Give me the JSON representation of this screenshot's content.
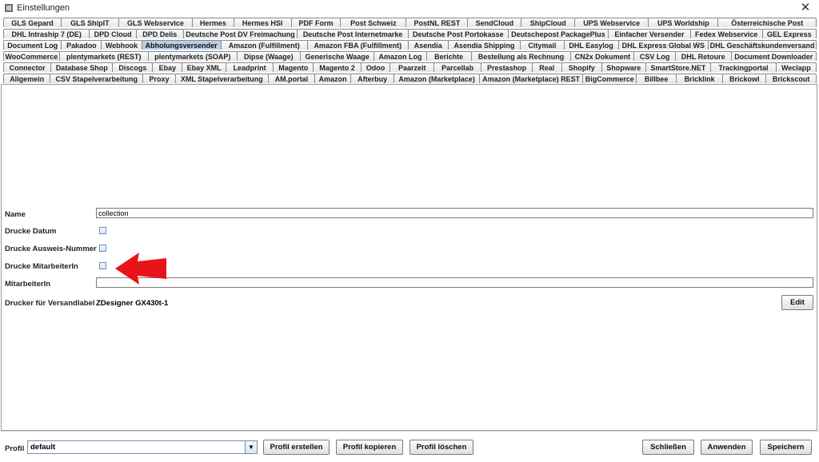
{
  "window": {
    "title": "Einstellungen",
    "close": "✕"
  },
  "tabs": {
    "rows": [
      [
        "GLS Gepard",
        "GLS ShipIT",
        "GLS Webservice",
        "Hermes",
        "Hermes HSI",
        "PDF Form",
        "Post Schweiz",
        "PostNL REST",
        "SendCloud",
        "ShipCloud",
        "UPS Webservice",
        "UPS Worldship",
        "Österreichische Post"
      ],
      [
        "DHL Intraship 7 (DE)",
        "DPD Cloud",
        "DPD Delis",
        "Deutsche Post DV Freimachung",
        "Deutsche Post Internetmarke",
        "Deutsche Post Portokasse",
        "Deutschepost PackagePlus",
        "Einfacher Versender",
        "Fedex Webservice",
        "GEL Express"
      ],
      [
        "Document Log",
        "Pakadoo",
        "Webhook",
        "Abholungsversender",
        "Amazon (Fulfillment)",
        "Amazon FBA (Fulfillment)",
        "Asendia",
        "Asendia Shipping",
        "Citymail",
        "DHL Easylog",
        "DHL Express Global WS",
        "DHL Geschäftskundenversand"
      ],
      [
        "WooCommerce",
        "plentymarkets (REST)",
        "plentymarkets (SOAP)",
        "Dipse (Waage)",
        "Generische Waage",
        "Amazon Log",
        "Berichte",
        "Bestellung als Rechnung",
        "CN2x Dokument",
        "CSV Log",
        "DHL Retoure",
        "Document Downloader"
      ],
      [
        "Connector",
        "Database Shop",
        "Discogs",
        "Ebay",
        "Ebay XML",
        "Leadprint",
        "Magento",
        "Magento 2",
        "Odoo",
        "Paarzeit",
        "Parcellab",
        "Prestashop",
        "Real",
        "Shopify",
        "Shopware",
        "SmartStore.NET",
        "Trackingportal",
        "Weclapp"
      ],
      [
        "Allgemein",
        "CSV Stapelverarbeitung",
        "Proxy",
        "XML Stapelverarbeitung",
        "AM.portal",
        "Amazon",
        "Afterbuy",
        "Amazon (Marketplace)",
        "Amazon (Marketplace) REST",
        "BigCommerce",
        "Billbee",
        "Bricklink",
        "Brickowl",
        "Brickscout"
      ]
    ],
    "active": "Abholungsversender"
  },
  "form": {
    "name_label": "Name",
    "name_value": "collection",
    "datum_label": "Drucke Datum",
    "ausweis_label": "Drucke Ausweis-Nummer",
    "mitarbeiter_check_label": "Drucke MitarbeiterIn",
    "mitarbeiter_label": "MitarbeiterIn",
    "mitarbeiter_value": "",
    "drucker_label": "Drucker für Versandlabel",
    "drucker_value": "ZDesigner GX430t-1",
    "edit_label": "Edit"
  },
  "bottom": {
    "profil_label": "Profil",
    "profil_value": "default",
    "profil_erstellen": "Profil erstellen",
    "profil_kopieren": "Profil kopieren",
    "profil_loeschen": "Profil löschen",
    "schliessen": "Schließen",
    "anwenden": "Anwenden",
    "speichern": "Speichern"
  },
  "colors": {
    "active_tab": "#b8cfe5",
    "annotation_arrow": "#e8141a"
  }
}
